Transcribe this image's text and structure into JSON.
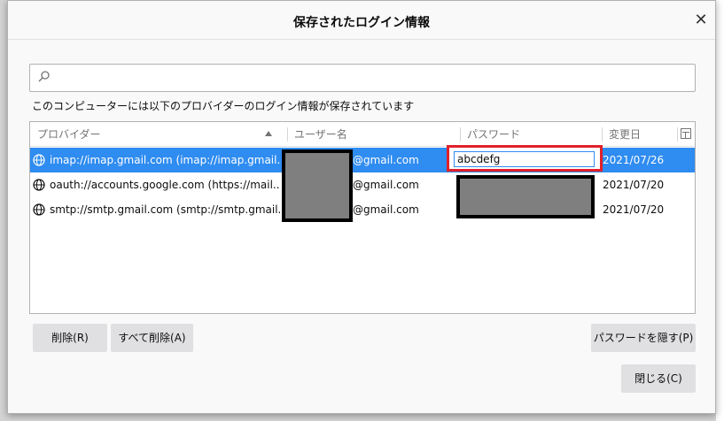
{
  "dialog": {
    "title": "保存されたログイン情報",
    "close_glyph": "✕"
  },
  "search": {
    "placeholder": "",
    "value": ""
  },
  "intro_text": "このコンピューターには以下のプロバイダーのログイン情報が保存されています",
  "table": {
    "columns": [
      "プロバイダー",
      "ユーザー名",
      "パスワード",
      "変更日"
    ],
    "rows": [
      {
        "provider": "imap://imap.gmail.com (imap://imap.gmail...",
        "username": "@gmail.com",
        "password": "abcdefg",
        "date": "2021/07/26",
        "selected": true
      },
      {
        "provider": "oauth://accounts.google.com (https://mail...",
        "username": "@gmail.com",
        "password": "",
        "date": "2021/07/20",
        "selected": false
      },
      {
        "provider": "smtp://smtp.gmail.com (smtp://smtp.gmail...",
        "username": "@gmail.com",
        "password": "",
        "date": "2021/07/20",
        "selected": false
      }
    ]
  },
  "buttons": {
    "delete": "削除(R)",
    "delete_all": "すべて削除(A)",
    "hide_passwords": "パスワードを隠す(P)",
    "close": "閉じる(C)"
  },
  "icons": [
    "search-icon",
    "globe-icon",
    "close-icon",
    "column-picker-icon",
    "sort-ascending-icon"
  ],
  "colors": {
    "selection": "#2f8cf0",
    "highlight_border": "#e0202a",
    "redaction": "#7f7f7f"
  }
}
